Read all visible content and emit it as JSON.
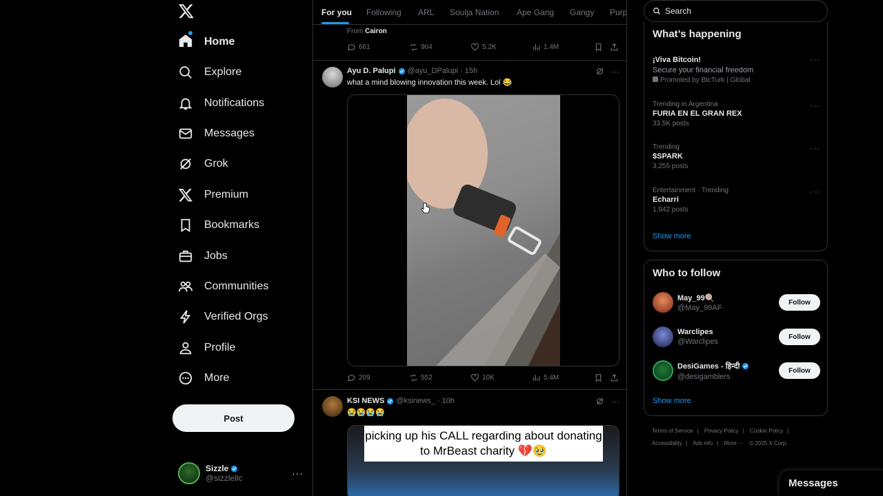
{
  "nav": {
    "items": [
      {
        "label": "Home",
        "icon": "home-icon"
      },
      {
        "label": "Explore",
        "icon": "search-icon"
      },
      {
        "label": "Notifications",
        "icon": "bell-icon"
      },
      {
        "label": "Messages",
        "icon": "mail-icon"
      },
      {
        "label": "Grok",
        "icon": "grok-icon"
      },
      {
        "label": "Premium",
        "icon": "x-logo-icon"
      },
      {
        "label": "Bookmarks",
        "icon": "bookmark-icon"
      },
      {
        "label": "Jobs",
        "icon": "briefcase-icon"
      },
      {
        "label": "Communities",
        "icon": "people-icon"
      },
      {
        "label": "Verified Orgs",
        "icon": "lightning-icon"
      },
      {
        "label": "Profile",
        "icon": "person-icon"
      },
      {
        "label": "More",
        "icon": "more-circle-icon"
      }
    ],
    "post_label": "Post",
    "account": {
      "name": "Sizzle",
      "handle": "@sizzlellc",
      "more": "···"
    }
  },
  "tabs": [
    "For you",
    "Following",
    "ARL",
    "Soulja Nation",
    "Ape Gang",
    "Gangy",
    "Purp"
  ],
  "feed": {
    "prev_post": {
      "from_prefix": "From ",
      "from_name": "Cairon",
      "replies": "661",
      "reposts": "904",
      "likes": "5.2K",
      "views": "1.4M"
    },
    "post1": {
      "name": "Ayu D. Palupi",
      "handle": "@ayu_DPalupi",
      "time": "· 15h",
      "text": "what a mind blowing innovation this week. Lol 😂",
      "replies": "209",
      "reposts": "552",
      "likes": "10K",
      "views": "5.4M"
    },
    "post2": {
      "name": "KSI NEWS",
      "handle": "@ksinews_",
      "time": "· 10h",
      "text": "😭😭😭😭",
      "caption": "picking up his CALL regarding about donating to MrBeast charity 💔🥹"
    }
  },
  "search": {
    "placeholder": "Search"
  },
  "happening": {
    "title": "What’s happening",
    "items": [
      {
        "meta": "",
        "title": "¡Viva Bitcoin!",
        "sub": "Secure your financial freedom",
        "promo": "Promoted by BtcTurk | Global"
      },
      {
        "meta": "Trending in Argentina",
        "title": "FURIA EN EL GRAN REX",
        "sub": "33.5K posts"
      },
      {
        "meta": "Trending",
        "title": "$SPARK",
        "sub": "3,255 posts"
      },
      {
        "meta": "Entertainment · Trending",
        "title": "Echarri",
        "sub": "1,942 posts"
      }
    ],
    "show_more": "Show more"
  },
  "who_to_follow": {
    "title": "Who to follow",
    "items": [
      {
        "name": "May_99🍭",
        "handle": "@May_99AF",
        "verified": false
      },
      {
        "name": "Warclipes",
        "handle": "@Warclipes",
        "verified": false
      },
      {
        "name": "DesiGames - हिन्दी",
        "handle": "@desigamblers",
        "verified": true
      }
    ],
    "follow_label": "Follow",
    "show_more": "Show more"
  },
  "footer": {
    "links": [
      "Terms of Service",
      "|",
      "Privacy Policy",
      "|",
      "Cookie Policy",
      "|",
      "Accessibility",
      "|",
      "Ads info",
      "|",
      "More ···",
      "© 2025 X Corp."
    ]
  },
  "messages_drawer": "Messages",
  "colors": {
    "accent": "#1d9bf0",
    "background": "#000000",
    "border": "#2f3336",
    "muted": "#71767b"
  }
}
